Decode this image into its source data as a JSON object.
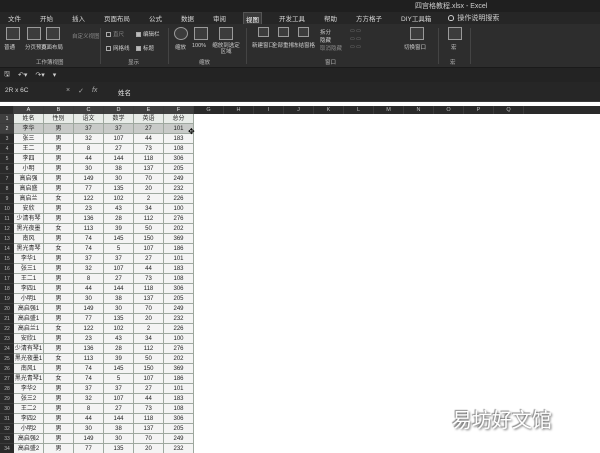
{
  "window": {
    "title": "四宫格教程.xlsx  -  Excel"
  },
  "menu": {
    "tabs": [
      "文件",
      "开始",
      "插入",
      "页面布局",
      "公式",
      "数据",
      "审阅",
      "视图",
      "开发工具",
      "帮助",
      "方方格子",
      "DIY工具箱"
    ],
    "active_index": 7,
    "tell_me": "操作说明搜索"
  },
  "ribbon": {
    "workbook_views": {
      "normal": "普通",
      "page_break": "分页预览",
      "page_layout": "页面布局",
      "custom": "自定义视图",
      "group": "工作簿视图"
    },
    "show": {
      "ruler": "直尺",
      "formula_bar": "编辑栏",
      "gridlines": "网格线",
      "headings": "标题",
      "group": "显示"
    },
    "zoom": {
      "zoom": "缩放",
      "hundred": "100%",
      "to_selection": "缩放到选定区域",
      "group": "缩放"
    },
    "window": {
      "new_window": "新建窗口",
      "arrange_all": "全部重排",
      "freeze": "冻结窗格",
      "split": "拆分",
      "hide": "隐藏",
      "unhide": "取消隐藏",
      "group": "窗口"
    },
    "switch_windows": "切换窗口",
    "macros": {
      "macros": "宏",
      "group": "宏"
    }
  },
  "formula_bar": {
    "name_box": "2R x 6C",
    "cancel": "×",
    "enter": "✓",
    "fx": "fx",
    "content": "姓名"
  },
  "columns": [
    "A",
    "B",
    "C",
    "D",
    "E",
    "F",
    "G",
    "H",
    "I",
    "J",
    "K",
    "L",
    "M",
    "N",
    "O",
    "P",
    "Q"
  ],
  "row_numbers": [
    "1",
    "2",
    "3",
    "4",
    "5",
    "6",
    "7",
    "8",
    "9",
    "10",
    "11",
    "12",
    "13",
    "14",
    "15",
    "16",
    "17",
    "18",
    "19",
    "20",
    "21",
    "22",
    "23",
    "24",
    "25",
    "26",
    "27",
    "28",
    "29",
    "30",
    "31",
    "32",
    "33",
    "34"
  ],
  "table": {
    "headers": [
      "姓名",
      "性别",
      "语文",
      "数学",
      "英语",
      "总分"
    ],
    "rows": [
      [
        "李华",
        "男",
        "37",
        "37",
        "27",
        "101"
      ],
      [
        "张三",
        "男",
        "32",
        "107",
        "44",
        "183"
      ],
      [
        "王二",
        "男",
        "8",
        "27",
        "73",
        "108"
      ],
      [
        "李四",
        "男",
        "44",
        "144",
        "118",
        "306"
      ],
      [
        "小明",
        "男",
        "30",
        "38",
        "137",
        "205"
      ],
      [
        "高启强",
        "男",
        "149",
        "30",
        "70",
        "249"
      ],
      [
        "高启盛",
        "男",
        "77",
        "135",
        "20",
        "232"
      ],
      [
        "高启兰",
        "女",
        "122",
        "102",
        "2",
        "226"
      ],
      [
        "安欣",
        "男",
        "23",
        "43",
        "34",
        "100"
      ],
      [
        "少清有琴",
        "男",
        "136",
        "28",
        "112",
        "276"
      ],
      [
        "黑光夜墨",
        "女",
        "113",
        "39",
        "50",
        "202"
      ],
      [
        "南风",
        "男",
        "74",
        "145",
        "150",
        "369"
      ],
      [
        "黑光青琴",
        "女",
        "74",
        "5",
        "107",
        "186"
      ],
      [
        "李华1",
        "男",
        "37",
        "37",
        "27",
        "101"
      ],
      [
        "张三1",
        "男",
        "32",
        "107",
        "44",
        "183"
      ],
      [
        "王二1",
        "男",
        "8",
        "27",
        "73",
        "108"
      ],
      [
        "李四1",
        "男",
        "44",
        "144",
        "118",
        "306"
      ],
      [
        "小明1",
        "男",
        "30",
        "38",
        "137",
        "205"
      ],
      [
        "高启强1",
        "男",
        "149",
        "30",
        "70",
        "249"
      ],
      [
        "高启盛1",
        "男",
        "77",
        "135",
        "20",
        "232"
      ],
      [
        "高启兰1",
        "女",
        "122",
        "102",
        "2",
        "226"
      ],
      [
        "安欣1",
        "男",
        "23",
        "43",
        "34",
        "100"
      ],
      [
        "少清有琴1",
        "男",
        "136",
        "28",
        "112",
        "276"
      ],
      [
        "黑光夜墨1",
        "女",
        "113",
        "39",
        "50",
        "202"
      ],
      [
        "南风1",
        "男",
        "74",
        "145",
        "150",
        "369"
      ],
      [
        "黑光青琴1",
        "女",
        "74",
        "5",
        "107",
        "186"
      ],
      [
        "李华2",
        "男",
        "37",
        "37",
        "27",
        "101"
      ],
      [
        "张三2",
        "男",
        "32",
        "107",
        "44",
        "183"
      ],
      [
        "王二2",
        "男",
        "8",
        "27",
        "73",
        "108"
      ],
      [
        "李四2",
        "男",
        "44",
        "144",
        "118",
        "306"
      ],
      [
        "小明2",
        "男",
        "30",
        "38",
        "137",
        "205"
      ],
      [
        "高启强2",
        "男",
        "149",
        "30",
        "70",
        "249"
      ],
      [
        "高启盛2",
        "男",
        "77",
        "135",
        "20",
        "232"
      ]
    ]
  },
  "watermark": "易坊好文馆",
  "colors": {
    "dark_bg": "#262626",
    "header_row": "#e8ece8",
    "selected_row": "#c8cac8"
  }
}
